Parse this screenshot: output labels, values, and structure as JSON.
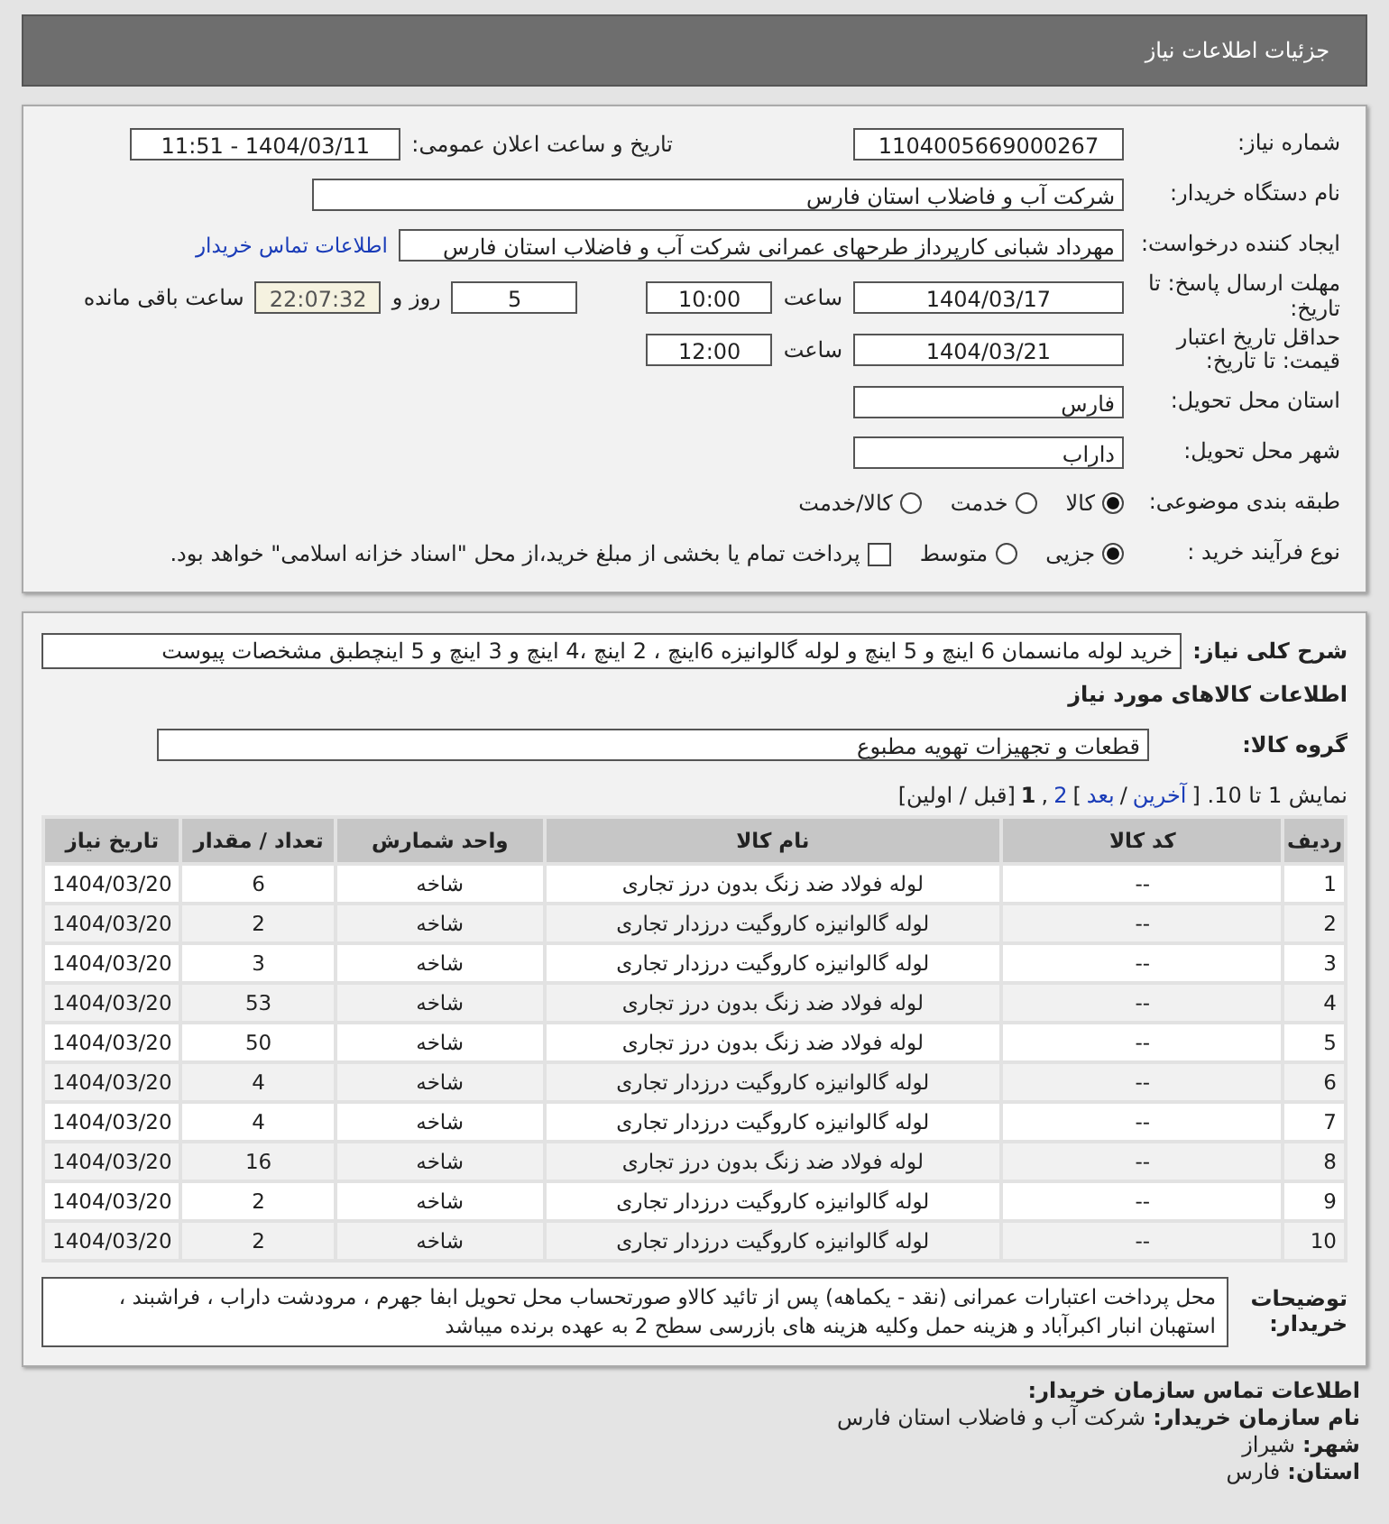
{
  "header": {
    "title": "جزئیات اطلاعات نیاز"
  },
  "need_number": {
    "label": "شماره نیاز:",
    "value": "1104005669000267"
  },
  "announce": {
    "label": "تاریخ و ساعت اعلان عمومی:",
    "value": "1404/03/11 - 11:51"
  },
  "buyer_org": {
    "label": "نام دستگاه خریدار:",
    "value": "شرکت آب و فاضلاب استان فارس"
  },
  "creator": {
    "label": "ایجاد کننده درخواست:",
    "value": "مهرداد شبانی کارپرداز طرحهای عمرانی  شرکت آب و فاضلاب استان فارس",
    "link": "اطلاعات تماس خریدار"
  },
  "reply_deadline": {
    "label": "مهلت ارسال پاسخ: تا تاریخ:",
    "date": "1404/03/17",
    "time_label": "ساعت",
    "time": "10:00",
    "days": "5",
    "days_label": "روز و",
    "remaining": "22:07:32",
    "remaining_label": "ساعت باقی مانده"
  },
  "price_validity": {
    "label": "حداقل تاریخ اعتبار قیمت: تا تاریخ:",
    "date": "1404/03/21",
    "time_label": "ساعت",
    "time": "12:00"
  },
  "province": {
    "label": "استان محل تحویل:",
    "value": "فارس"
  },
  "city": {
    "label": "شهر محل تحویل:",
    "value": "داراب"
  },
  "category": {
    "label": "طبقه بندی موضوعی:",
    "options": [
      {
        "label": "کالا",
        "selected": true
      },
      {
        "label": "خدمت",
        "selected": false
      },
      {
        "label": "کالا/خدمت",
        "selected": false
      }
    ]
  },
  "process": {
    "label": "نوع فرآیند خرید :",
    "options": [
      {
        "label": "جزیی",
        "selected": true
      },
      {
        "label": "متوسط",
        "selected": false
      }
    ],
    "treasury": {
      "checked": false,
      "label": "پرداخت تمام یا بخشی از مبلغ خرید،از محل \"اسناد خزانه اسلامی\" خواهد بود."
    }
  },
  "description": {
    "label": "شرح کلی نیاز:",
    "value": "خرید لوله مانسمان 6 اینچ و 5 اینچ و لوله گالوانیزه 6اینچ ، 2 اینچ ،4 اینچ و 3 اینچ و 5 اینچطبق مشخصات پیوست"
  },
  "goods_heading": "اطلاعات کالاهای مورد نیاز",
  "goods_group": {
    "label": "گروه کالا:",
    "value": "قطعات و تجهیزات تهویه مطبوع"
  },
  "pagination": [
    {
      "kind": "text",
      "text": "نمایش 1 تا 10. ["
    },
    {
      "kind": "link",
      "text": "آخرین"
    },
    {
      "kind": "text",
      "text": "/"
    },
    {
      "kind": "link",
      "text": "بعد"
    },
    {
      "kind": "text",
      "text": "]"
    },
    {
      "kind": "link",
      "text": "2"
    },
    {
      "kind": "text",
      "text": ","
    },
    {
      "kind": "current",
      "text": "1"
    },
    {
      "kind": "text",
      "text": "[قبل / اولین]"
    }
  ],
  "table": {
    "columns": [
      "ردیف",
      "کد کالا",
      "نام کالا",
      "واحد شمارش",
      "تعداد / مقدار",
      "تاریخ نیاز"
    ],
    "rows": [
      [
        "1",
        "--",
        "لوله فولاد ضد زنگ بدون درز تجاری",
        "شاخه",
        "6",
        "1404/03/20"
      ],
      [
        "2",
        "--",
        "لوله گالوانیزه کاروگیت درزدار تجاری",
        "شاخه",
        "2",
        "1404/03/20"
      ],
      [
        "3",
        "--",
        "لوله گالوانیزه کاروگیت درزدار تجاری",
        "شاخه",
        "3",
        "1404/03/20"
      ],
      [
        "4",
        "--",
        "لوله فولاد ضد زنگ بدون درز تجاری",
        "شاخه",
        "53",
        "1404/03/20"
      ],
      [
        "5",
        "--",
        "لوله فولاد ضد زنگ بدون درز تجاری",
        "شاخه",
        "50",
        "1404/03/20"
      ],
      [
        "6",
        "--",
        "لوله گالوانیزه کاروگیت درزدار تجاری",
        "شاخه",
        "4",
        "1404/03/20"
      ],
      [
        "7",
        "--",
        "لوله گالوانیزه کاروگیت درزدار تجاری",
        "شاخه",
        "4",
        "1404/03/20"
      ],
      [
        "8",
        "--",
        "لوله فولاد ضد زنگ بدون درز تجاری",
        "شاخه",
        "16",
        "1404/03/20"
      ],
      [
        "9",
        "--",
        "لوله گالوانیزه کاروگیت درزدار تجاری",
        "شاخه",
        "2",
        "1404/03/20"
      ],
      [
        "10",
        "--",
        "لوله گالوانیزه کاروگیت درزدار تجاری",
        "شاخه",
        "2",
        "1404/03/20"
      ]
    ]
  },
  "buyer_notes": {
    "label": "توضیحات خریدار:",
    "value": "محل پرداخت اعتبارات عمرانی (نقد - یکماهه) پس از تائید کالاو صورتحساب محل تحویل ابفا جهرم ، مرودشت داراب ، فراشبند ، استهبان انبار اکبرآباد و هزینه حمل وکلیه هزینه های بازرسی سطح 2 به عهده برنده میباشد"
  },
  "contact": {
    "heading": "اطلاعات تماس سازمان خریدار:",
    "lines": [
      {
        "label": "نام سازمان خریدار:",
        "value": "شرکت آب و فاضلاب استان فارس"
      },
      {
        "label": "شهر:",
        "value": "شیراز"
      },
      {
        "label": "استان:",
        "value": "فارس"
      }
    ]
  }
}
